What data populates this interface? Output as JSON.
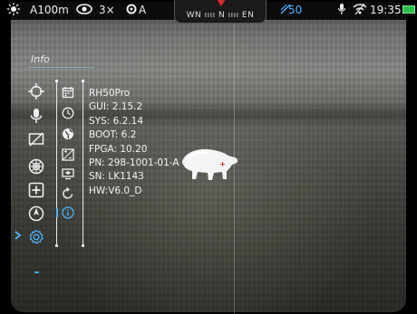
{
  "status_bar": {
    "brightness_icon": "sun-icon",
    "range": "A100m",
    "view_mode_icon": "eye-icon",
    "zoom": "3×",
    "calibration_mode": "A",
    "compass": {
      "text": "WN ıııı N ıııı EN"
    },
    "stream_icon": "stream-icon",
    "stream_value": "50",
    "mic_icon": "microphone-icon",
    "wifi_icon": "wifi-icon",
    "time": "19:35",
    "battery_color": "#2bbf4a"
  },
  "menu": {
    "title": "Info",
    "main_icons": [
      "crosshair-icon",
      "microphone-icon",
      "display-off-icon",
      "palette-icon",
      "plus-square-icon",
      "compass-icon",
      "settings-icon"
    ],
    "sub_icons": [
      "calendar-icon",
      "clock-icon",
      "globe-icon",
      "contrast-icon",
      "screen-icon",
      "reset-icon",
      "info-icon"
    ],
    "selected_color": "#4fb0ff"
  },
  "device_info": {
    "model": "RH50Pro",
    "gui": "GUI: 2.15.2",
    "sys": "SYS: 6.2.14",
    "boot": "BOOT: 6.2",
    "fpga": "FPGA: 10.20",
    "pn": "PN: 298-1001-01-A",
    "sn": "SN: LK1143",
    "hw": "HW:V6.0_D"
  }
}
